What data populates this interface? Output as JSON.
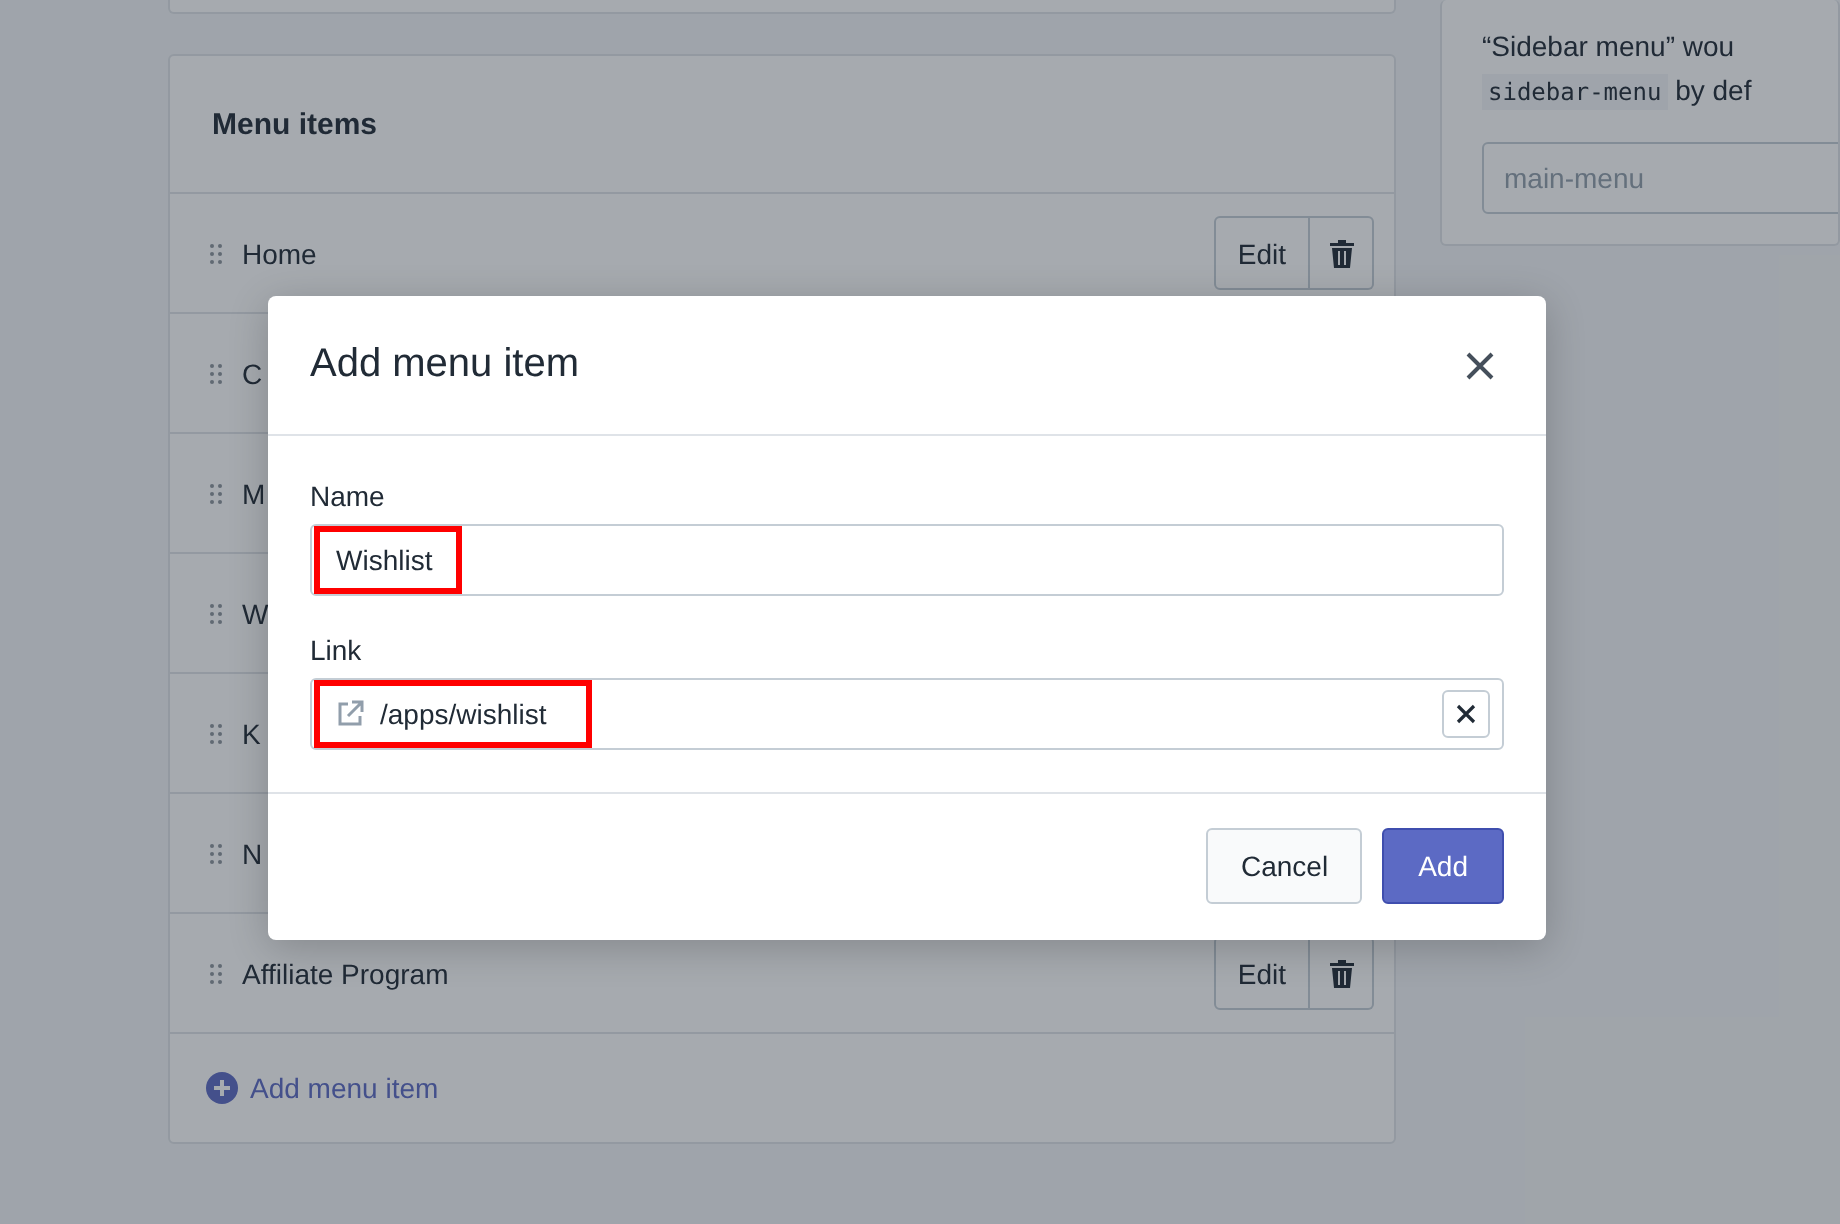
{
  "menu_card": {
    "title": "Menu items",
    "items": [
      {
        "label": "Home",
        "edit_label": "Edit"
      },
      {
        "label": "C"
      },
      {
        "label": "M"
      },
      {
        "label": "W"
      },
      {
        "label": "K"
      },
      {
        "label": "N"
      },
      {
        "label": "Affiliate Program",
        "edit_label": "Edit"
      }
    ],
    "add_link": "Add menu item"
  },
  "side_card": {
    "text_before": "“Sidebar menu” wou",
    "code": "sidebar-menu",
    "text_after": "by def",
    "handle_placeholder": "main-menu"
  },
  "modal": {
    "title": "Add menu item",
    "fields": [
      {
        "kind": "text",
        "label": "Name",
        "value": "Wishlist",
        "highlighted": true
      },
      {
        "kind": "link",
        "label": "Link",
        "value": "/apps/wishlist",
        "highlighted": true
      }
    ],
    "buttons": [
      {
        "label": "Cancel",
        "primary": false
      },
      {
        "label": "Add",
        "primary": true
      }
    ]
  }
}
